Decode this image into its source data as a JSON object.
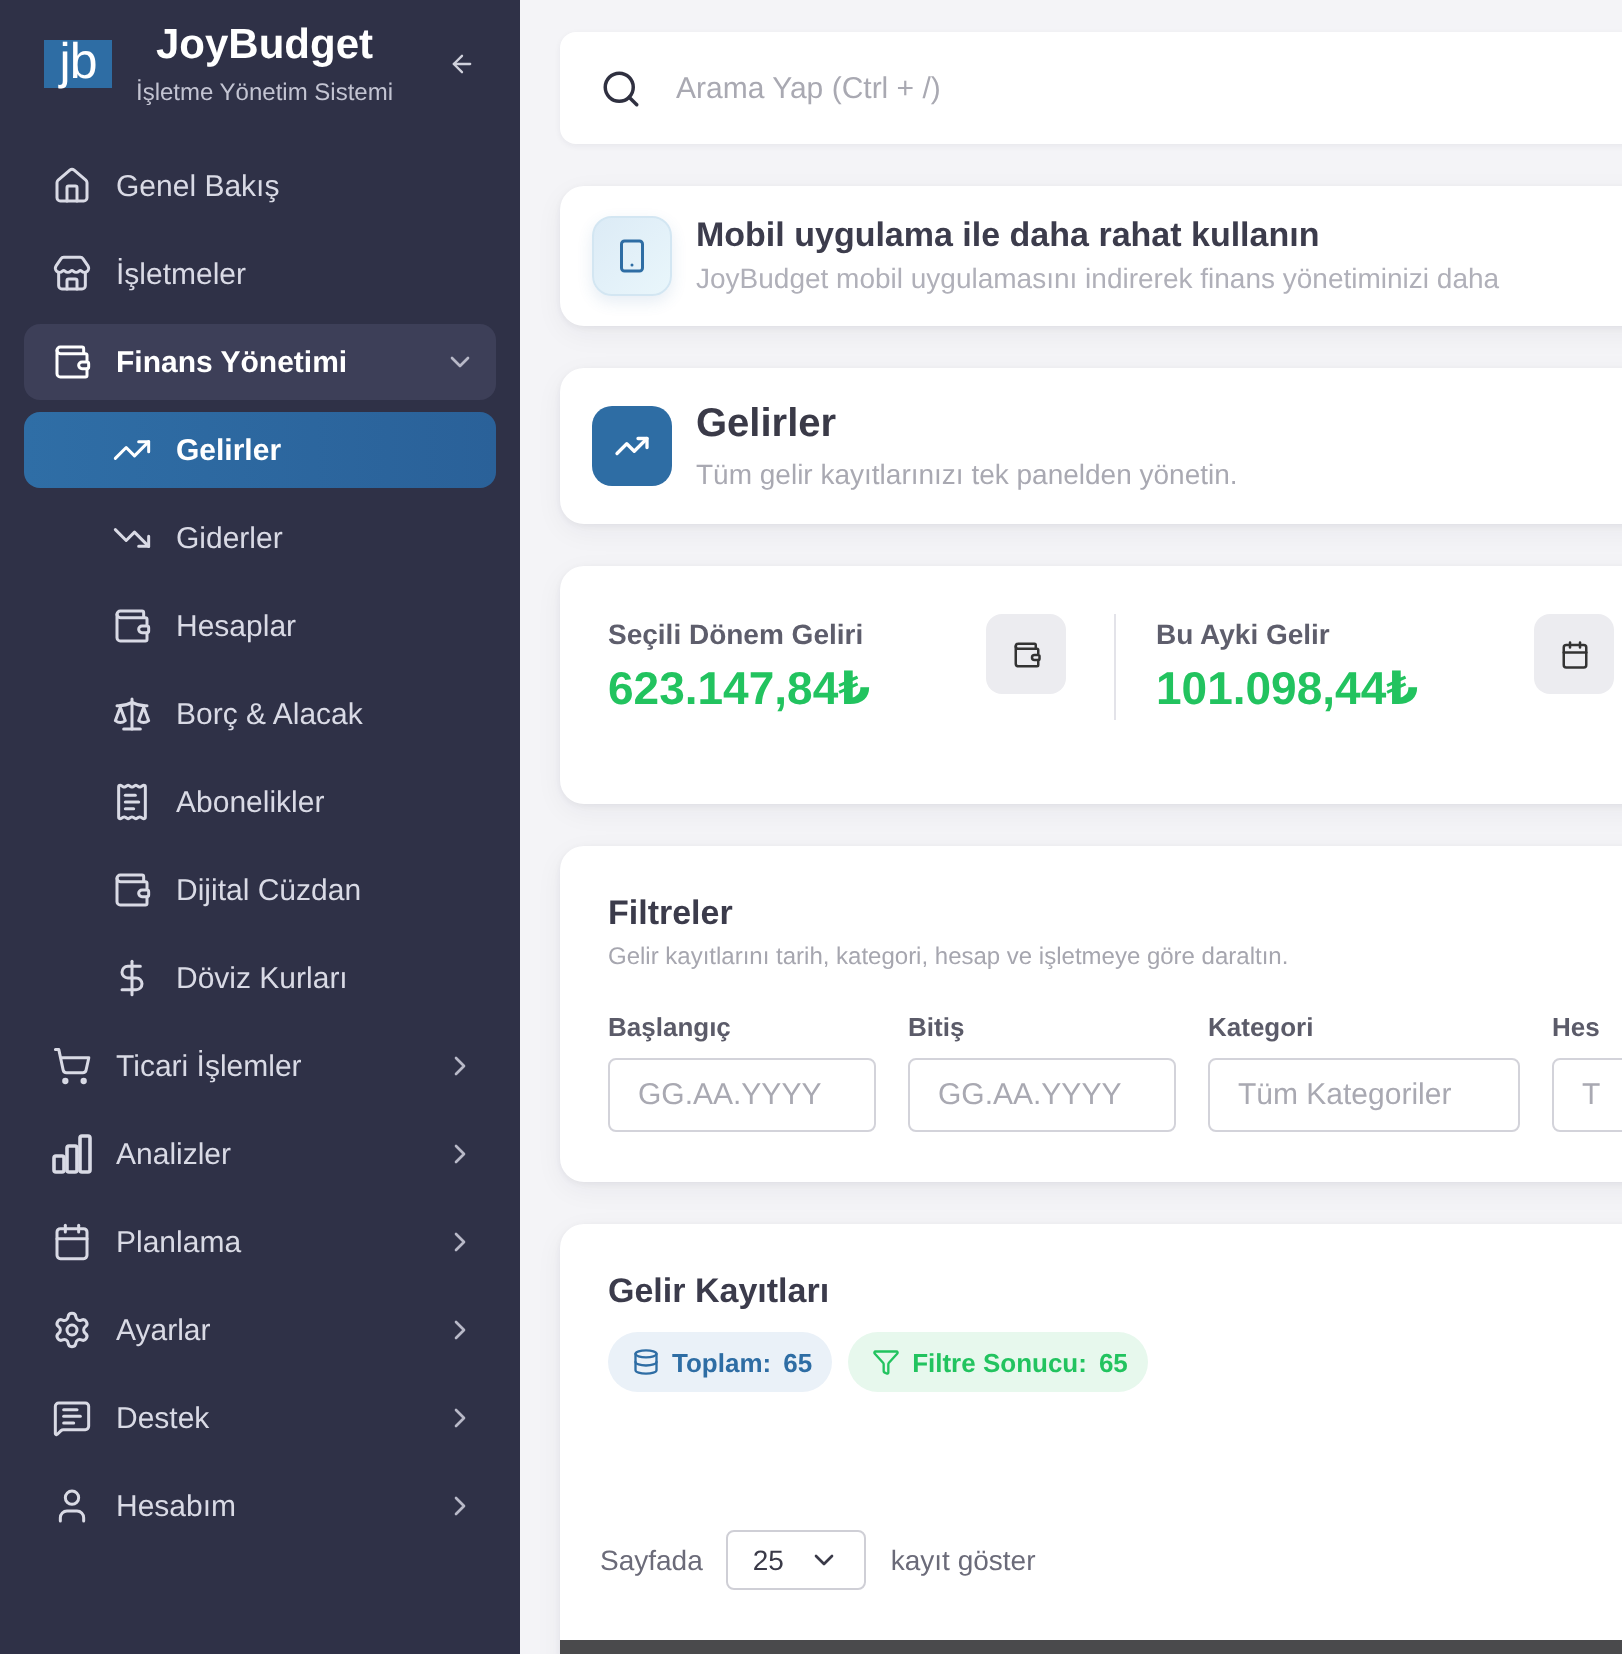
{
  "sidebar": {
    "logo_mark": "jb",
    "app_name": "JoyBudget",
    "app_subtitle": "İşletme Yönetim Sistemi",
    "items": [
      {
        "label": "Genel Bakış",
        "kind": "link",
        "selected": false
      },
      {
        "label": "İşletmeler",
        "kind": "link",
        "selected": false
      },
      {
        "label": "Finans Yönetimi",
        "kind": "group",
        "expanded": true,
        "selected": false,
        "children": [
          {
            "label": "Gelirler",
            "selected": true
          },
          {
            "label": "Giderler",
            "selected": false
          },
          {
            "label": "Hesaplar",
            "selected": false
          },
          {
            "label": "Borç & Alacak",
            "selected": false
          },
          {
            "label": "Abonelikler",
            "selected": false
          },
          {
            "label": "Dijital Cüzdan",
            "selected": false
          },
          {
            "label": "Döviz Kurları",
            "selected": false
          }
        ]
      },
      {
        "label": "Ticari İşlemler",
        "kind": "group",
        "expanded": false,
        "selected": false
      },
      {
        "label": "Analizler",
        "kind": "group",
        "expanded": false,
        "selected": false
      },
      {
        "label": "Planlama",
        "kind": "group",
        "expanded": false,
        "selected": false
      },
      {
        "label": "Ayarlar",
        "kind": "group",
        "expanded": false,
        "selected": false
      },
      {
        "label": "Destek",
        "kind": "group",
        "expanded": false,
        "selected": false
      },
      {
        "label": "Hesabım",
        "kind": "group",
        "expanded": false,
        "selected": false
      }
    ]
  },
  "search": {
    "placeholder": "Arama Yap (Ctrl + /)"
  },
  "app_banner": {
    "title": "Mobil uygulama ile daha rahat kullanın",
    "text": "JoyBudget mobil uygulamasını indirerek finans yönetiminizi daha"
  },
  "page_header": {
    "title": "Gelirler",
    "subtitle": "Tüm gelir kayıtlarınızı tek panelden yönetin."
  },
  "stats": [
    {
      "label": "Seçili Dönem Geliri",
      "value": "623.147,84₺"
    },
    {
      "label": "Bu Ayki Gelir",
      "value": "101.098,44₺"
    }
  ],
  "filters": {
    "title": "Filtreler",
    "subtitle": "Gelir kayıtlarını tarih, kategori, hesap ve işletmeye göre daraltın.",
    "fields": [
      {
        "label": "Başlangıç",
        "placeholder": "GG.AA.YYYY"
      },
      {
        "label": "Bitiş",
        "placeholder": "GG.AA.YYYY"
      },
      {
        "label": "Kategori",
        "placeholder": "Tüm Kategoriler"
      },
      {
        "label": "Hes",
        "placeholder": "T"
      }
    ]
  },
  "records": {
    "title": "Gelir Kayıtları",
    "badges": [
      {
        "kind": "total",
        "label": "Toplam:",
        "value": "65"
      },
      {
        "kind": "filtered",
        "label": "Filtre Sonucu:",
        "value": "65"
      }
    ],
    "page_size": {
      "before": "Sayfada",
      "value": "25",
      "after": "kayıt göster"
    }
  }
}
